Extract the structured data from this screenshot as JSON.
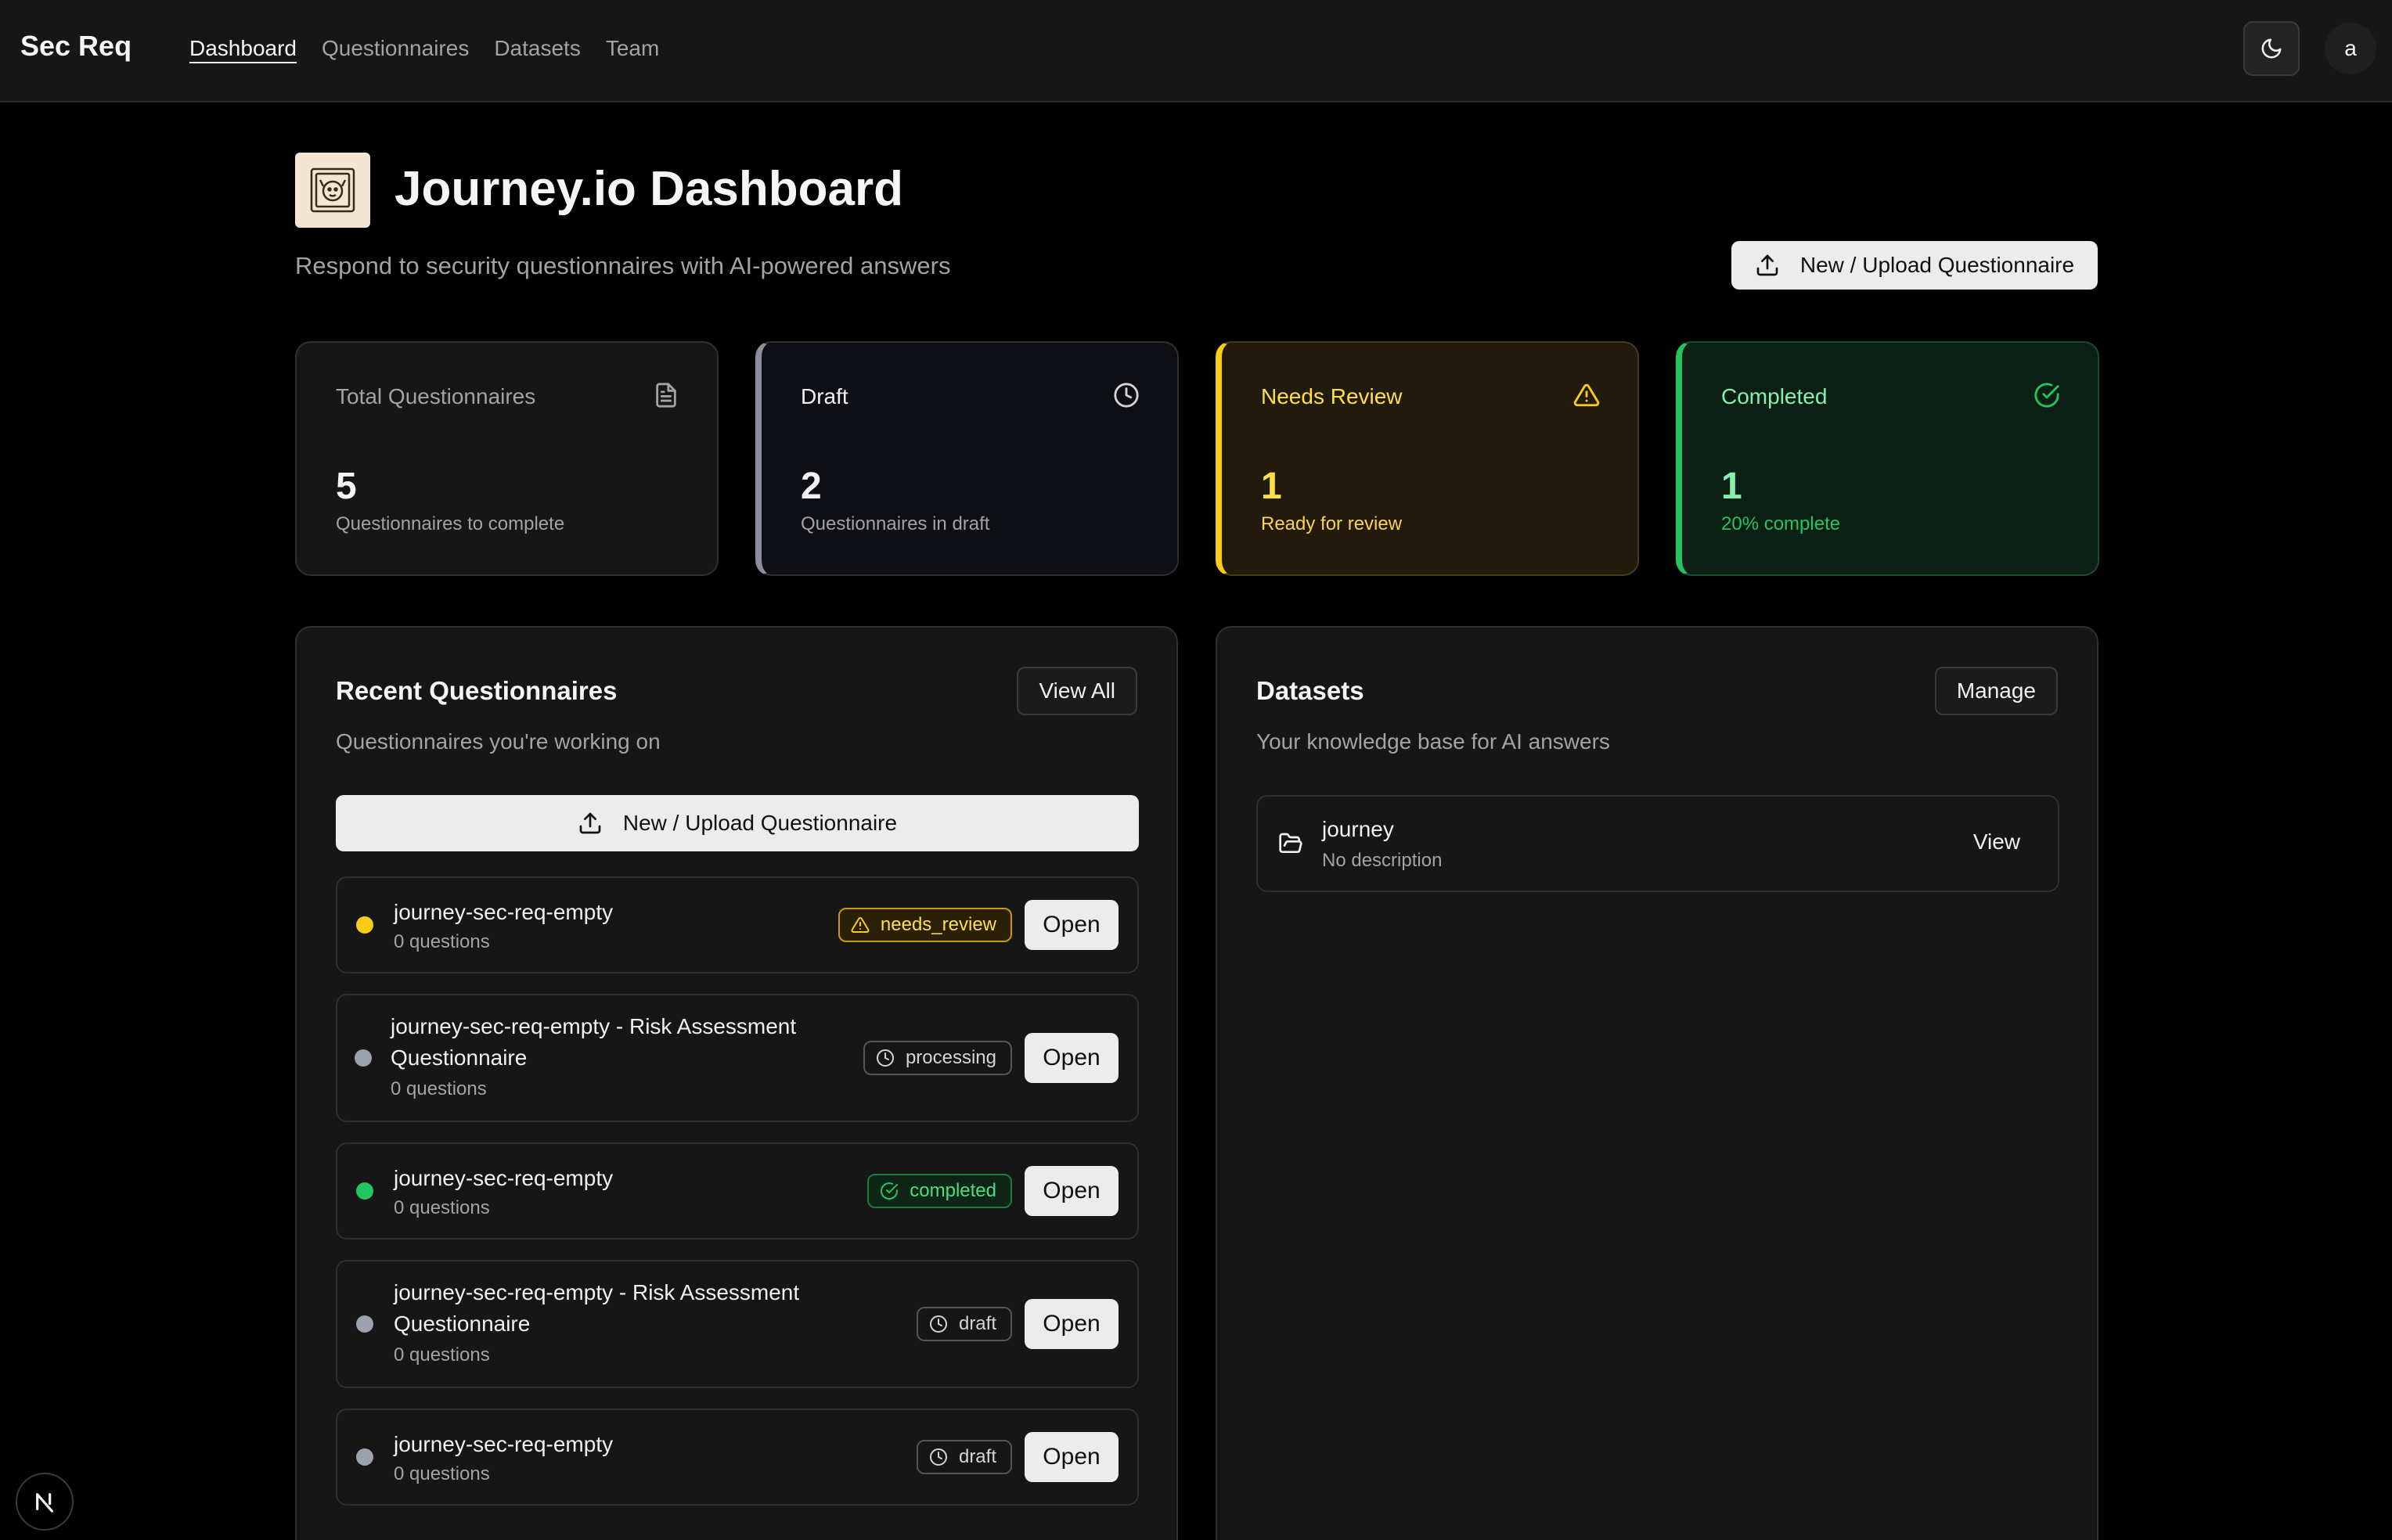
{
  "nav": {
    "brand": "Sec Req",
    "links": [
      "Dashboard",
      "Questionnaires",
      "Datasets",
      "Team"
    ],
    "active": "Dashboard",
    "avatar_initial": "a"
  },
  "header": {
    "title": "Journey.io Dashboard",
    "subtitle": "Respond to security questionnaires with AI-powered answers",
    "upload_label": "New / Upload Questionnaire"
  },
  "stats": {
    "total": {
      "label": "Total Questionnaires",
      "value": "5",
      "sub": "Questionnaires to complete",
      "icon": "document-icon"
    },
    "draft": {
      "label": "Draft",
      "value": "2",
      "sub": "Questionnaires in draft",
      "icon": "clock-icon"
    },
    "review": {
      "label": "Needs Review",
      "value": "1",
      "sub": "Ready for review",
      "icon": "warning-icon"
    },
    "completed": {
      "label": "Completed",
      "value": "1",
      "sub": "20% complete",
      "icon": "check-circle-icon"
    }
  },
  "recent": {
    "title": "Recent Questionnaires",
    "description": "Questionnaires you're working on",
    "view_all_label": "View All",
    "upload_label": "New / Upload Questionnaire",
    "open_label": "Open",
    "items": [
      {
        "name": "journey-sec-req-empty",
        "count": "0 questions",
        "status": "needs_review",
        "dot_color": "#facc15"
      },
      {
        "name": "journey-sec-req-empty - Risk Assessment Questionnaire",
        "count": "0 questions",
        "status": "processing",
        "dot_color": "#9ca3af"
      },
      {
        "name": "journey-sec-req-empty",
        "count": "0 questions",
        "status": "completed",
        "dot_color": "#22c55e"
      },
      {
        "name": "journey-sec-req-empty - Risk Assessment Questionnaire",
        "count": "0 questions",
        "status": "draft",
        "dot_color": "#9ca3af"
      },
      {
        "name": "journey-sec-req-empty",
        "count": "0 questions",
        "status": "draft",
        "dot_color": "#9ca3af"
      }
    ]
  },
  "datasets": {
    "title": "Datasets",
    "description": "Your knowledge base for AI answers",
    "manage_label": "Manage",
    "items": [
      {
        "name": "journey",
        "description": "No description",
        "view_label": "View",
        "icon": "folder-open-icon"
      }
    ]
  },
  "colors": {
    "review": "#facc15",
    "completed": "#22c55e",
    "draft": "#8b8f99",
    "background": "#000000",
    "card": "#161616"
  },
  "footer_badge": "N"
}
